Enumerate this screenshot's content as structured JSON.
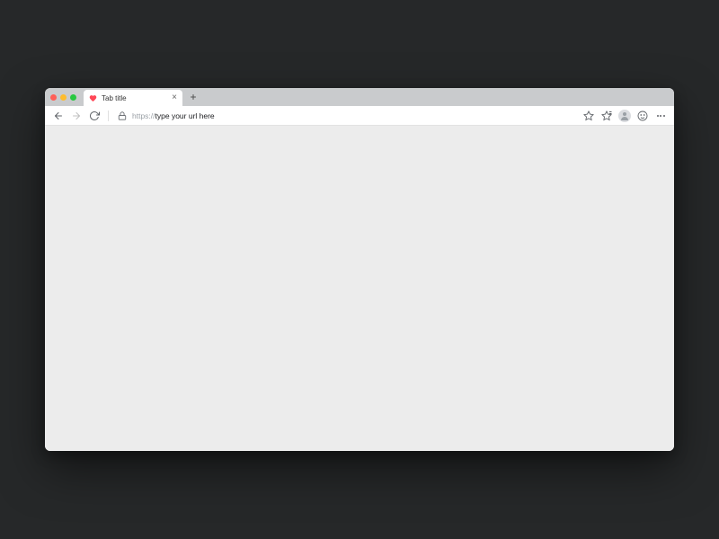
{
  "tab": {
    "title": "Tab title"
  },
  "addressBar": {
    "protocol": "https://",
    "url": "type your url here"
  }
}
